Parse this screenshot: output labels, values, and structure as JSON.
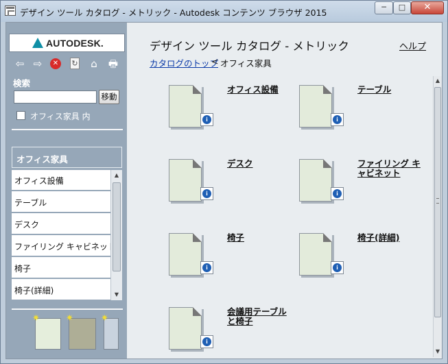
{
  "window": {
    "title": "デザイン ツール カタログ - メトリック - Autodesk コンテンツ ブラウザ 2015",
    "minimize": "─",
    "maximize": "□",
    "close": "✕"
  },
  "sidebar": {
    "logo_text": "AUTODESK.",
    "nav_icons": [
      "back-icon",
      "forward-icon",
      "stop-icon",
      "refresh-icon",
      "home-icon",
      "print-icon"
    ],
    "nav_glyphs": {
      "back": "⇦",
      "forward": "⇨",
      "stop": "✕",
      "refresh": "↻",
      "home": "⌂",
      "print": "🖶"
    },
    "search_label": "検索",
    "search_value": "",
    "search_button": "移動",
    "scope_checkbox_label": "オフィス家具 内",
    "section_header": "オフィス家具",
    "items": [
      {
        "label": "オフィス設備"
      },
      {
        "label": "テーブル"
      },
      {
        "label": "デスク"
      },
      {
        "label": "ファイリング キャビネット"
      },
      {
        "label": "椅子"
      },
      {
        "label": "椅子(詳細)"
      }
    ],
    "scroll_up": "▲",
    "scroll_down": "▼",
    "spark": "✷"
  },
  "main": {
    "title": "デザイン ツール カタログ  -  メトリック",
    "help_link": "ヘルプ",
    "breadcrumb_link": "カタログのトップ",
    "breadcrumb_sep": "<",
    "breadcrumb_current": "オフィス家具",
    "info_glyph": "i",
    "catalog_items": [
      {
        "label": "オフィス設備"
      },
      {
        "label": "テーブル"
      },
      {
        "label": "デスク"
      },
      {
        "label": "ファイリング キャビネット"
      },
      {
        "label": "椅子"
      },
      {
        "label": "椅子(詳細)"
      },
      {
        "label": "会議用テーブルと椅子"
      }
    ],
    "scroll_up": "▲",
    "scroll_down": "▼"
  },
  "colors": {
    "sidebar_bg": "#96a7b8",
    "link": "#0b3aa8",
    "close_button": "#c8473a",
    "info_icon": "#1f5fb4"
  }
}
